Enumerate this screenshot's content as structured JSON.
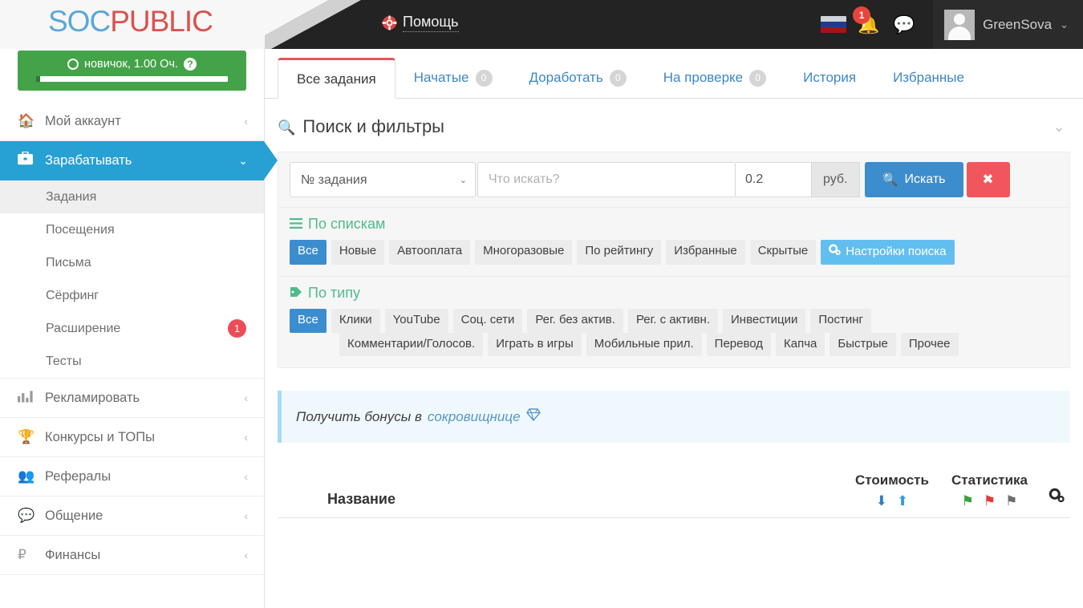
{
  "header": {
    "logo_soc": "SOC",
    "logo_public": "PUBLIC",
    "help_label": "Помощь",
    "help_icon": "life-buoy-icon",
    "flag_icon": "russian-flag-icon",
    "bell_icon": "bell-icon",
    "notification_count": "1",
    "chat_icon": "chat-bubble-icon",
    "avatar_icon": "user-avatar",
    "user_name": "GreenSova",
    "caret_icon": "chevron-down-icon"
  },
  "sidebar": {
    "rank": {
      "icon": "circle-icon",
      "text": "новичок, 1.00 Оч.",
      "help_icon": "question-mark-icon",
      "progress_percent": 2
    },
    "items": [
      {
        "label": "Мой аккаунт",
        "icon": "home-icon",
        "chevron": "‹",
        "name": "my-account"
      },
      {
        "label": "Зарабатывать",
        "icon": "briefcase-icon",
        "chevron": "⌄",
        "name": "earn",
        "active": true
      },
      {
        "label": "Рекламировать",
        "icon": "bar-chart-icon",
        "chevron": "‹",
        "name": "advertise"
      },
      {
        "label": "Конкурсы и ТОПы",
        "icon": "trophy-icon",
        "chevron": "‹",
        "name": "contests"
      },
      {
        "label": "Рефералы",
        "icon": "users-icon",
        "chevron": "‹",
        "name": "referrals"
      },
      {
        "label": "Общение",
        "icon": "comments-icon",
        "chevron": "‹",
        "name": "communication"
      },
      {
        "label": "Финансы",
        "icon": "ruble-icon",
        "chevron": "‹",
        "name": "finance"
      }
    ],
    "subitems": [
      {
        "label": "Задания",
        "current": true,
        "name": "tasks"
      },
      {
        "label": "Посещения",
        "name": "visits"
      },
      {
        "label": "Письма",
        "name": "letters"
      },
      {
        "label": "Сёрфинг",
        "name": "surfing"
      },
      {
        "label": "Расширение",
        "badge": "1",
        "name": "extension"
      },
      {
        "label": "Тесты",
        "name": "tests"
      }
    ]
  },
  "tabs": [
    {
      "label": "Все задания",
      "active": true,
      "name": "all-tasks"
    },
    {
      "label": "Начатые",
      "count": "0",
      "name": "started"
    },
    {
      "label": "Доработать",
      "count": "0",
      "name": "rework"
    },
    {
      "label": "На проверке",
      "count": "0",
      "name": "in-review"
    },
    {
      "label": "История",
      "name": "history"
    },
    {
      "label": "Избранные",
      "name": "favorites"
    }
  ],
  "filters": {
    "title": "Поиск и фильтры",
    "search_icon": "search-icon",
    "collapse_icon": "chevron-down-icon",
    "select_value": "№ задания",
    "select_options": [
      "№ задания"
    ],
    "query_placeholder": "Что искать?",
    "query_value": "",
    "price_value": "0.2",
    "price_addon": "руб.",
    "search_button": "Искать",
    "clear_button": "✖",
    "lists": {
      "title": "По спискам",
      "icon": "list-icon",
      "chips": [
        {
          "label": "Все",
          "active": true
        },
        {
          "label": "Новые"
        },
        {
          "label": "Автооплата"
        },
        {
          "label": "Многоразовые"
        },
        {
          "label": "По рейтингу"
        },
        {
          "label": "Избранные"
        },
        {
          "label": "Скрытые"
        }
      ],
      "settings_chip": {
        "label": "Настройки поиска",
        "icon": "gears-icon"
      }
    },
    "types": {
      "title": "По типу",
      "icon": "tag-icon",
      "row1": [
        {
          "label": "Все",
          "active": true
        },
        {
          "label": "Клики"
        },
        {
          "label": "YouTube"
        },
        {
          "label": "Соц. сети"
        },
        {
          "label": "Рег. без актив."
        },
        {
          "label": "Рег. с активн."
        },
        {
          "label": "Инвестиции"
        },
        {
          "label": "Постинг"
        }
      ],
      "row2": [
        {
          "label": "Комментарии/Голосов."
        },
        {
          "label": "Играть в игры"
        },
        {
          "label": "Мобильные прил."
        },
        {
          "label": "Перевод"
        },
        {
          "label": "Капча"
        },
        {
          "label": "Быстрые"
        },
        {
          "label": "Прочее"
        }
      ]
    }
  },
  "bonus": {
    "text": "Получить бонусы в",
    "link": "сокровищнице",
    "icon": "gem-icon"
  },
  "table": {
    "col_name": "Название",
    "col_cost": "Стоимость",
    "col_stats": "Статистика",
    "sort_down_icon": "arrow-down-icon",
    "sort_up_icon": "arrow-up-icon",
    "flag_green_icon": "flag-green-icon",
    "flag_red_icon": "flag-red-icon",
    "flag_gray_icon": "flag-gray-icon",
    "settings_icon": "gears-icon"
  },
  "colors": {
    "accent_blue": "#3b8dce",
    "sidebar_active": "#27a0d4",
    "green": "#44a349",
    "red": "#f0565c",
    "tab_active_border": "#e2575c",
    "light_blue": "#63bef0"
  }
}
